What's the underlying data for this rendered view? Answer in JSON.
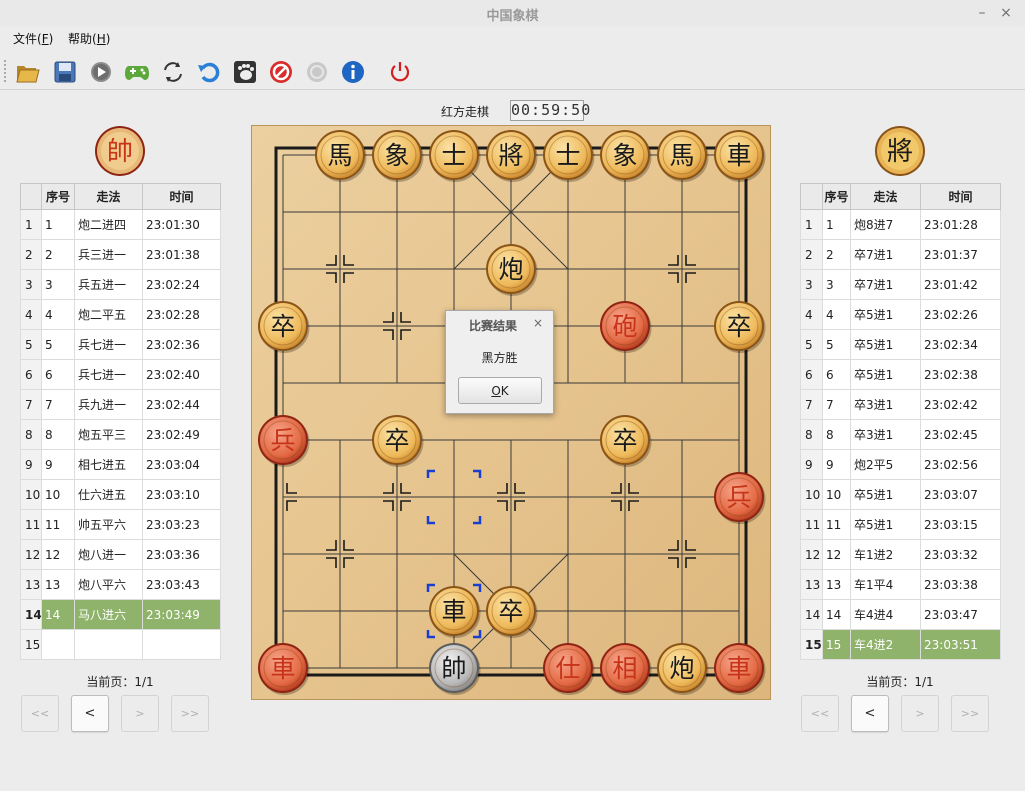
{
  "window": {
    "title": "中国象棋",
    "minimize": "–",
    "close": "×"
  },
  "menu": [
    {
      "label": "文件(",
      "accel": "F",
      "tail": ")"
    },
    {
      "label": "帮助(",
      "accel": "H",
      "tail": ")"
    }
  ],
  "toolbar": [
    "open-folder-icon",
    "save-disk-icon",
    "play-icon",
    "gamepad-icon",
    "swap-arrows-icon",
    "undo-icon",
    "gnome-foot-icon",
    "forbidden-icon",
    "disabled-circle-icon",
    "info-icon",
    "power-icon"
  ],
  "status": {
    "turn": "红方走棋",
    "clock": "00:59:50"
  },
  "colors": {
    "red_piece": "#c8341a",
    "black_piece": "#1a1a1a",
    "selected_row": "#8fb36a",
    "board": "#e8c993"
  },
  "left_panel": {
    "head_piece": "帥",
    "columns": [
      "序号",
      "走法",
      "时间"
    ],
    "rows": [
      {
        "row": "1",
        "num": "1",
        "move": "炮二进四",
        "time": "23:01:30"
      },
      {
        "row": "2",
        "num": "2",
        "move": "兵三进一",
        "time": "23:01:38"
      },
      {
        "row": "3",
        "num": "3",
        "move": "兵五进一",
        "time": "23:02:24"
      },
      {
        "row": "4",
        "num": "4",
        "move": "炮二平五",
        "time": "23:02:28"
      },
      {
        "row": "5",
        "num": "5",
        "move": "兵七进一",
        "time": "23:02:36"
      },
      {
        "row": "6",
        "num": "6",
        "move": "兵七进一",
        "time": "23:02:40"
      },
      {
        "row": "7",
        "num": "7",
        "move": "兵九进一",
        "time": "23:02:44"
      },
      {
        "row": "8",
        "num": "8",
        "move": "炮五平三",
        "time": "23:02:49"
      },
      {
        "row": "9",
        "num": "9",
        "move": "相七进五",
        "time": "23:03:04"
      },
      {
        "row": "10",
        "num": "10",
        "move": "仕六进五",
        "time": "23:03:10"
      },
      {
        "row": "11",
        "num": "11",
        "move": "帅五平六",
        "time": "23:03:23"
      },
      {
        "row": "12",
        "num": "12",
        "move": "炮八进一",
        "time": "23:03:36"
      },
      {
        "row": "13",
        "num": "13",
        "move": "炮八平六",
        "time": "23:03:43"
      },
      {
        "row": "14",
        "num": "14",
        "move": "马八进六",
        "time": "23:03:49"
      },
      {
        "row": "15",
        "num": "",
        "move": "",
        "time": ""
      }
    ],
    "selected_row": 14,
    "page": "当前页：1/1",
    "nav": [
      "<<",
      "<",
      ">",
      ">>"
    ]
  },
  "right_panel": {
    "head_piece": "將",
    "columns": [
      "序号",
      "走法",
      "时间"
    ],
    "rows": [
      {
        "row": "1",
        "num": "1",
        "move": "炮8进7",
        "time": "23:01:28"
      },
      {
        "row": "2",
        "num": "2",
        "move": "卒7进1",
        "time": "23:01:37"
      },
      {
        "row": "3",
        "num": "3",
        "move": "卒7进1",
        "time": "23:01:42"
      },
      {
        "row": "4",
        "num": "4",
        "move": "卒5进1",
        "time": "23:02:26"
      },
      {
        "row": "5",
        "num": "5",
        "move": "卒5进1",
        "time": "23:02:34"
      },
      {
        "row": "6",
        "num": "6",
        "move": "卒5进1",
        "time": "23:02:38"
      },
      {
        "row": "7",
        "num": "7",
        "move": "卒3进1",
        "time": "23:02:42"
      },
      {
        "row": "8",
        "num": "8",
        "move": "卒3进1",
        "time": "23:02:45"
      },
      {
        "row": "9",
        "num": "9",
        "move": "炮2平5",
        "time": "23:02:56"
      },
      {
        "row": "10",
        "num": "10",
        "move": "卒5进1",
        "time": "23:03:07"
      },
      {
        "row": "11",
        "num": "11",
        "move": "卒5进1",
        "time": "23:03:15"
      },
      {
        "row": "12",
        "num": "12",
        "move": "车1进2",
        "time": "23:03:32"
      },
      {
        "row": "13",
        "num": "13",
        "move": "车1平4",
        "time": "23:03:38"
      },
      {
        "row": "14",
        "num": "14",
        "move": "车4进4",
        "time": "23:03:47"
      },
      {
        "row": "15",
        "num": "15",
        "move": "车4进2",
        "time": "23:03:51"
      }
    ],
    "selected_row": 15,
    "page": "当前页：1/1",
    "nav": [
      "<<",
      "<",
      ">",
      ">>"
    ]
  },
  "board": {
    "pieces": [
      {
        "ch": "馬",
        "side": "black",
        "file": 1,
        "rank": 0
      },
      {
        "ch": "象",
        "side": "black",
        "file": 2,
        "rank": 0
      },
      {
        "ch": "士",
        "side": "black",
        "file": 3,
        "rank": 0
      },
      {
        "ch": "將",
        "side": "black",
        "file": 4,
        "rank": 0
      },
      {
        "ch": "士",
        "side": "black",
        "file": 5,
        "rank": 0
      },
      {
        "ch": "象",
        "side": "black",
        "file": 6,
        "rank": 0
      },
      {
        "ch": "馬",
        "side": "black",
        "file": 7,
        "rank": 0
      },
      {
        "ch": "車",
        "side": "black",
        "file": 8,
        "rank": 0
      },
      {
        "ch": "炮",
        "side": "black",
        "file": 4,
        "rank": 2
      },
      {
        "ch": "卒",
        "side": "black",
        "file": 0,
        "rank": 3
      },
      {
        "ch": "砲",
        "side": "red",
        "file": 6,
        "rank": 3
      },
      {
        "ch": "卒",
        "side": "black",
        "file": 8,
        "rank": 3
      },
      {
        "ch": "兵",
        "side": "red",
        "file": 0,
        "rank": 5
      },
      {
        "ch": "卒",
        "side": "black",
        "file": 2,
        "rank": 5
      },
      {
        "ch": "卒",
        "side": "black",
        "file": 6,
        "rank": 5
      },
      {
        "ch": "兵",
        "side": "red",
        "file": 8,
        "rank": 6
      },
      {
        "ch": "車",
        "side": "black",
        "file": 3,
        "rank": 8
      },
      {
        "ch": "卒",
        "side": "black",
        "file": 4,
        "rank": 8
      },
      {
        "ch": "車",
        "side": "red",
        "file": 0,
        "rank": 9
      },
      {
        "ch": "帥",
        "side": "grey",
        "file": 3,
        "rank": 9
      },
      {
        "ch": "仕",
        "side": "red",
        "file": 5,
        "rank": 9
      },
      {
        "ch": "相",
        "side": "red",
        "file": 6,
        "rank": 9
      },
      {
        "ch": "炮",
        "side": "black",
        "file": 7,
        "rank": 9
      },
      {
        "ch": "車",
        "side": "red",
        "file": 8,
        "rank": 9
      }
    ],
    "last_move_markers": [
      {
        "file": 3,
        "rank": 6
      },
      {
        "file": 3,
        "rank": 8
      }
    ]
  },
  "dialog": {
    "title": "比赛结果",
    "close": "×",
    "message": "黑方胜",
    "ok_prefix": "",
    "ok_accel": "O",
    "ok_tail": "K"
  }
}
